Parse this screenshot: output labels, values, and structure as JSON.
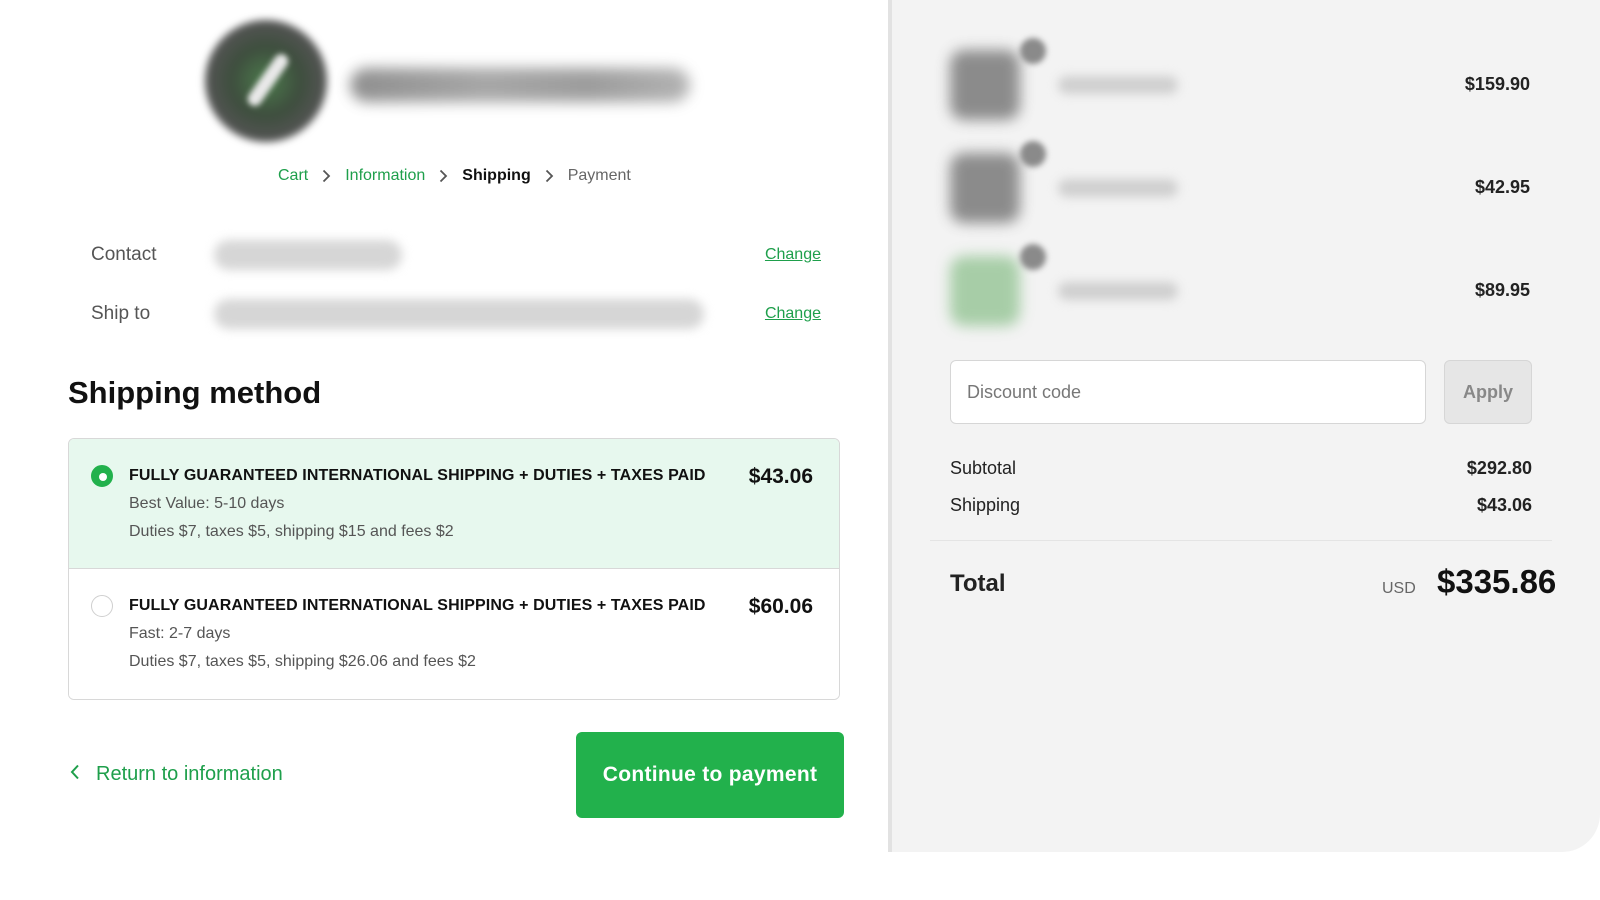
{
  "breadcrumb": {
    "items": [
      {
        "label": "Cart"
      },
      {
        "label": "Information"
      },
      {
        "label": "Shipping"
      },
      {
        "label": "Payment"
      }
    ]
  },
  "review": {
    "contact_label": "Contact",
    "ship_to_label": "Ship to",
    "change_label": "Change"
  },
  "shipping": {
    "title": "Shipping method",
    "options": [
      {
        "title": "FULLY GUARANTEED INTERNATIONAL SHIPPING + DUTIES + TAXES PAID",
        "line1": "Best Value: 5-10 days",
        "line2": "Duties $7, taxes $5, shipping $15 and fees $2",
        "price": "$43.06",
        "selected": true
      },
      {
        "title": "FULLY GUARANTEED INTERNATIONAL SHIPPING + DUTIES + TAXES PAID",
        "line1": "Fast: 2-7 days",
        "line2": "Duties $7, taxes $5, shipping $26.06 and fees $2",
        "price": "$60.06",
        "selected": false
      }
    ]
  },
  "actions": {
    "return_label": "Return to information",
    "continue_label": "Continue to payment"
  },
  "summary": {
    "products": [
      {
        "price": "$159.90"
      },
      {
        "price": "$42.95"
      },
      {
        "price": "$89.95"
      }
    ],
    "discount_placeholder": "Discount code",
    "apply_label": "Apply",
    "subtotal_label": "Subtotal",
    "subtotal_value": "$292.80",
    "shipping_label": "Shipping",
    "shipping_value": "$43.06",
    "total_label": "Total",
    "currency": "USD",
    "total_value": "$335.86"
  },
  "colors": {
    "accent": "#22b14c",
    "link": "#1e9f4b",
    "selected_bg": "#e7f8ee",
    "summary_bg": "#f3f3f3"
  }
}
